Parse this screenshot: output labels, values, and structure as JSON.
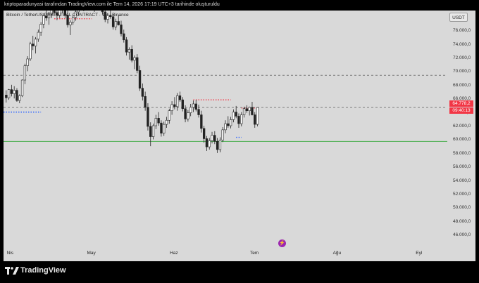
{
  "caption": "kriptoparadunyasi tarafından TradingView.com ile Tem 14, 2026 17:19 UTC+3 tarihinde oluşturuldu",
  "symbol": "Bitcoin / TetherUS PERPETUAL CONTRACT · 1G · Binance",
  "currency_button": "USDT",
  "brand": "TradingView",
  "last_price_label": "64.778,2",
  "countdown_label": "09:40:13",
  "colors": {
    "background": "#d9d9d9",
    "candle": "#ffffff",
    "wick": "#222222",
    "resistance": "#f23645",
    "support_blue": "#2962ff",
    "support_line": "#4caf50",
    "price_tag": "#f23645"
  },
  "chart_data": {
    "type": "candlestick",
    "title": "Bitcoin / TetherUS PERPETUAL CONTRACT · 1G · Binance",
    "ylim": [
      45000,
      79000
    ],
    "y_ticks": [
      "46.000,0",
      "48.000,0",
      "50.000,0",
      "52.000,0",
      "54.000,0",
      "56.000,0",
      "58.000,0",
      "60.000,0",
      "62.000,0",
      "64.000,0",
      "66.000,0",
      "68.000,0",
      "70.000,0",
      "72.000,0",
      "74.000,0",
      "76.000,0"
    ],
    "y_tick_values": [
      46000,
      48000,
      50000,
      52000,
      54000,
      56000,
      58000,
      60000,
      62000,
      64000,
      66000,
      68000,
      70000,
      72000,
      74000,
      76000
    ],
    "x_ticks": [
      {
        "label": "Nis",
        "day": 0
      },
      {
        "label": "May",
        "day": 30
      },
      {
        "label": "Haz",
        "day": 61
      },
      {
        "label": "Tem",
        "day": 91
      },
      {
        "label": "Ağu",
        "day": 122
      },
      {
        "label": "Eyl",
        "day": 153
      }
    ],
    "x_range_days": [
      -2,
      164
    ],
    "candles": [
      [
        -1,
        66600,
        67300,
        65500,
        66200
      ],
      [
        0,
        66200,
        67500,
        65900,
        67400
      ],
      [
        1,
        67400,
        68100,
        66400,
        66800
      ],
      [
        2,
        66800,
        67900,
        66100,
        67300
      ],
      [
        3,
        67300,
        67600,
        65600,
        65800
      ],
      [
        4,
        65800,
        66700,
        65400,
        66500
      ],
      [
        5,
        66500,
        68900,
        66300,
        68800
      ],
      [
        6,
        68800,
        71200,
        68200,
        70900
      ],
      [
        7,
        70900,
        72300,
        70100,
        71900
      ],
      [
        8,
        71900,
        74400,
        71600,
        74100
      ],
      [
        9,
        74100,
        75300,
        73200,
        73800
      ],
      [
        10,
        73800,
        75100,
        72700,
        74800
      ],
      [
        11,
        74800,
        76200,
        74400,
        75800
      ],
      [
        12,
        75800,
        77300,
        75300,
        77000
      ],
      [
        13,
        77000,
        78600,
        76400,
        78200
      ],
      [
        14,
        78200,
        79400,
        77500,
        77900
      ],
      [
        15,
        77900,
        78800,
        76900,
        78500
      ],
      [
        16,
        78500,
        79800,
        77900,
        79300
      ],
      [
        17,
        79300,
        80100,
        78300,
        78700
      ],
      [
        18,
        78700,
        79400,
        77600,
        78300
      ],
      [
        19,
        78300,
        79700,
        77900,
        79100
      ],
      [
        20,
        79100,
        80400,
        78600,
        79800
      ],
      [
        21,
        79800,
        80300,
        77900,
        78300
      ],
      [
        22,
        78300,
        79000,
        76500,
        76900
      ],
      [
        23,
        76900,
        77600,
        75400,
        77300
      ],
      [
        24,
        77300,
        78400,
        76900,
        78000
      ],
      [
        25,
        78000,
        79200,
        77500,
        78800
      ],
      [
        26,
        78800,
        80600,
        78300,
        80100
      ],
      [
        27,
        80100,
        81000,
        79400,
        79700
      ],
      [
        28,
        79700,
        80400,
        78900,
        80200
      ],
      [
        29,
        80200,
        81400,
        79800,
        81000
      ],
      [
        30,
        81000,
        81700,
        80200,
        80500
      ],
      [
        31,
        80500,
        81200,
        79100,
        79400
      ],
      [
        32,
        79400,
        80300,
        78800,
        79900
      ],
      [
        33,
        79900,
        81100,
        79400,
        80700
      ],
      [
        34,
        80700,
        81500,
        79900,
        80100
      ],
      [
        35,
        80100,
        80700,
        78400,
        78800
      ],
      [
        36,
        78800,
        79300,
        77300,
        77700
      ],
      [
        37,
        77700,
        78600,
        77100,
        78300
      ],
      [
        38,
        78300,
        79500,
        77800,
        78100
      ],
      [
        39,
        78100,
        78500,
        76200,
        76600
      ],
      [
        40,
        76600,
        77800,
        76100,
        77400
      ],
      [
        41,
        77400,
        78400,
        76800,
        76900
      ],
      [
        42,
        76900,
        77500,
        75200,
        75600
      ],
      [
        43,
        75600,
        76200,
        74300,
        74700
      ],
      [
        44,
        74700,
        75100,
        72400,
        72900
      ],
      [
        45,
        72900,
        73600,
        71800,
        73300
      ],
      [
        46,
        73300,
        73900,
        71400,
        71700
      ],
      [
        47,
        71700,
        72400,
        70400,
        72100
      ],
      [
        48,
        72100,
        72600,
        69800,
        70200
      ],
      [
        49,
        70200,
        70900,
        67200,
        67600
      ],
      [
        50,
        67600,
        68300,
        65800,
        66400
      ],
      [
        51,
        66400,
        67100,
        64300,
        64800
      ],
      [
        52,
        64800,
        65400,
        61400,
        62000
      ],
      [
        53,
        62000,
        62600,
        59100,
        60500
      ],
      [
        54,
        60500,
        62400,
        60100,
        62100
      ],
      [
        55,
        62100,
        63700,
        61600,
        63200
      ],
      [
        56,
        63200,
        64100,
        62100,
        62500
      ],
      [
        57,
        62500,
        62900,
        60500,
        61000
      ],
      [
        58,
        61000,
        62700,
        60600,
        62300
      ],
      [
        59,
        62300,
        63400,
        61800,
        62900
      ],
      [
        60,
        62900,
        64600,
        62400,
        64300
      ],
      [
        61,
        64300,
        65700,
        63700,
        65200
      ],
      [
        62,
        65200,
        66300,
        64500,
        64900
      ],
      [
        63,
        64900,
        66900,
        64300,
        66500
      ],
      [
        64,
        66500,
        67100,
        65600,
        65900
      ],
      [
        65,
        65900,
        66300,
        64200,
        64600
      ],
      [
        66,
        64600,
        65100,
        62600,
        63100
      ],
      [
        67,
        63100,
        64400,
        62700,
        64000
      ],
      [
        68,
        64000,
        65300,
        63500,
        64800
      ],
      [
        69,
        64800,
        65800,
        64100,
        65300
      ],
      [
        70,
        65300,
        65900,
        64200,
        64500
      ],
      [
        71,
        64500,
        65200,
        63300,
        63700
      ],
      [
        72,
        63700,
        64300,
        61100,
        61700
      ],
      [
        73,
        61700,
        62100,
        59600,
        60200
      ],
      [
        74,
        60200,
        60600,
        58400,
        59000
      ],
      [
        75,
        59000,
        60300,
        58600,
        59900
      ],
      [
        76,
        59900,
        61200,
        59500,
        60700
      ],
      [
        77,
        60700,
        61300,
        59400,
        59800
      ],
      [
        78,
        59800,
        60300,
        58100,
        58600
      ],
      [
        79,
        58600,
        60400,
        58200,
        60000
      ],
      [
        80,
        60000,
        61900,
        59700,
        61500
      ],
      [
        81,
        61500,
        62900,
        61000,
        62400
      ],
      [
        82,
        62400,
        63500,
        61800,
        62100
      ],
      [
        83,
        62100,
        63400,
        61700,
        63000
      ],
      [
        84,
        63000,
        64500,
        62600,
        64100
      ],
      [
        85,
        64100,
        65000,
        63200,
        63500
      ],
      [
        86,
        63500,
        63900,
        61800,
        62400
      ],
      [
        87,
        62400,
        64100,
        62000,
        63700
      ],
      [
        88,
        63700,
        64900,
        63300,
        64600
      ],
      [
        89,
        64600,
        65100,
        64000,
        64300
      ],
      [
        90,
        64300,
        64900,
        63600,
        64800
      ],
      [
        91,
        64800,
        65600,
        63600,
        63700
      ],
      [
        92,
        63700,
        64100,
        61800,
        62300
      ],
      [
        93,
        62300,
        64000,
        62000,
        64778
      ]
    ],
    "levels": [
      {
        "style": "dotted",
        "color": "red",
        "y": 77800,
        "from": 17,
        "to": 31
      },
      {
        "style": "dotted",
        "color": "blue",
        "y": 64100,
        "from": -2,
        "to": 12
      },
      {
        "style": "dashed",
        "color": "gray",
        "y": 69500,
        "from": -2,
        "to": 164
      },
      {
        "style": "solid",
        "color": "green",
        "y": 59800,
        "from": -2,
        "to": 164
      },
      {
        "style": "dotted",
        "color": "red",
        "y": 65900,
        "from": 69,
        "to": 83
      },
      {
        "style": "dotted",
        "color": "red",
        "y": 64700,
        "from": 87,
        "to": 93
      },
      {
        "style": "dotted",
        "color": "blue",
        "y": 60400,
        "from": 85,
        "to": 87
      },
      {
        "style": "dashed",
        "color": "gray",
        "y": 64778,
        "from": -2,
        "to": 164
      }
    ]
  }
}
